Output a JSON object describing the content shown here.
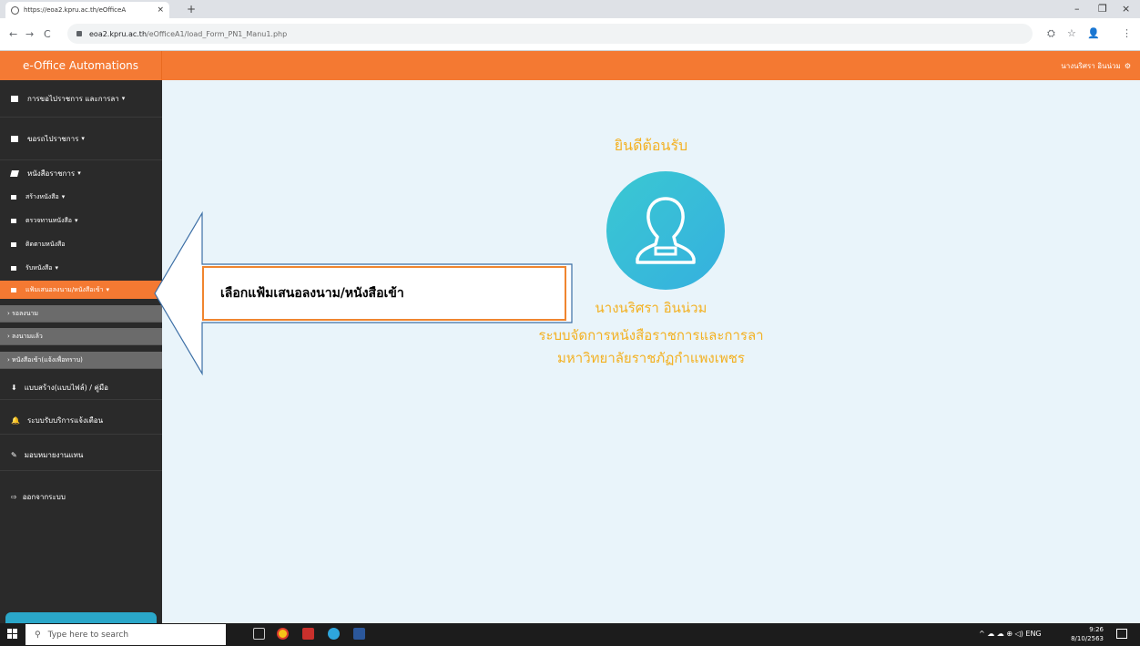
{
  "browser": {
    "tab_title": "https://eoa2.kpru.ac.th/eOfficeA",
    "tab_close": "×",
    "new_tab": "+",
    "url_host": "eoa2.kpru.ac.th",
    "url_path": "/eOfficeA1/load_Form_PN1_Manu1.php",
    "back": "←",
    "forward": "→",
    "reload": "C",
    "translate": "⛭",
    "star": "☆",
    "account": "👤",
    "menu": "⋮",
    "minimize": "–",
    "maximize": "❐",
    "close": "×"
  },
  "header": {
    "brand": "e-Office Automations",
    "user_name": "นางนริศรา อินน่วม",
    "user_icon": "⚙"
  },
  "sidebar": {
    "items": [
      {
        "label": "การขอไปราชการ และการลา",
        "caret": "▾"
      },
      {
        "label": "ขอรถไปราชการ",
        "caret": "▾"
      },
      {
        "label": "หนังสือราชการ",
        "caret": "▾"
      },
      {
        "label": "สร้างหนังสือ",
        "caret": "▾"
      },
      {
        "label": "ตรวจทานหนังสือ",
        "caret": "▾"
      },
      {
        "label": "ติดตามหนังสือ",
        "caret": ""
      },
      {
        "label": "รับหนังสือ",
        "caret": "▾"
      },
      {
        "label": "แฟ้มเสนอลงนาม/หนังสือเข้า",
        "caret": "▾"
      }
    ],
    "children": [
      "› รอลงนาม",
      "› ลงนามแล้ว",
      "› หนังสือเข้า(แจ้งเพื่อทราบ)"
    ],
    "more": [
      {
        "label": "แบบสร้าง(แบบไฟล์) / คู่มือ",
        "icon": "⬇"
      },
      {
        "label": "ระบบรับบริการแจ้งเตือน",
        "icon": "🔔"
      },
      {
        "label": "มอบหมายงานแทน",
        "icon": "✎"
      },
      {
        "label": "ออกจากระบบ",
        "icon": "⇨"
      }
    ]
  },
  "main": {
    "welcome": "ยินดีต้อนรับ",
    "user_name": "นางนริศรา อินน่วม",
    "system_line1": "ระบบจัดการหนังสือราชการและการลา",
    "system_line2": "มหาวิทยาลัยราชภัฏกำแพงเพชร"
  },
  "callout": {
    "text": "เลือกแฟ้มเสนอลงนาม/หนังสือเข้า"
  },
  "taskbar": {
    "search_placeholder": "Type here to search",
    "time": "9:26",
    "date": "8/10/2563",
    "tray": "^ ☁ ☁ ⊕ ◁) ENG"
  }
}
